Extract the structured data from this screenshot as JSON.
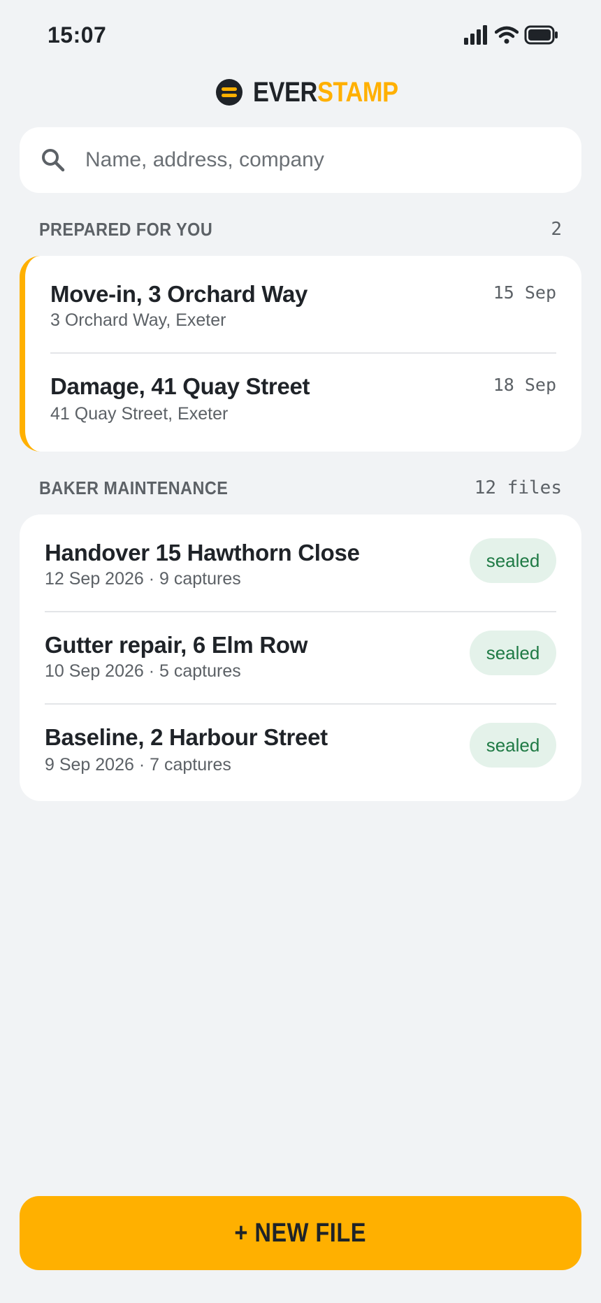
{
  "status_bar": {
    "time": "15:07",
    "icons": [
      "signal-icon",
      "wifi-icon",
      "battery-icon"
    ]
  },
  "brand": {
    "name_part1": "EVER",
    "name_part2": "STAMP",
    "logo_icon": "stamp-logo-icon",
    "colors": {
      "dark": "#1f2328",
      "accent": "#ffb000"
    }
  },
  "search": {
    "placeholder": "Name, address, company",
    "value": "",
    "icon": "search-icon"
  },
  "prepared_section": {
    "title": "PREPARED FOR YOU",
    "count": "2",
    "items": [
      {
        "title": "Move-in, 3 Orchard Way",
        "address": "3 Orchard Way, Exeter",
        "date": "15 Sep"
      },
      {
        "title": "Damage, 41 Quay Street",
        "address": "41 Quay Street, Exeter",
        "date": "18 Sep"
      }
    ]
  },
  "company_section": {
    "title": "BAKER MAINTENANCE",
    "count": "12 files",
    "items": [
      {
        "title": "Handover 15 Hawthorn Close",
        "meta": "12 Sep 2026 · 9 captures",
        "status": "sealed"
      },
      {
        "title": "Gutter repair, 6 Elm Row",
        "meta": "10 Sep 2026 · 5 captures",
        "status": "sealed"
      },
      {
        "title": "Baseline, 2 Harbour Street",
        "meta": "9 Sep 2026 · 7 captures",
        "status": "sealed"
      }
    ]
  },
  "actions": {
    "new_file_label": "+ NEW FILE"
  },
  "colors": {
    "background": "#f1f3f5",
    "accent": "#ffb000",
    "badge_bg": "#e4f2ea",
    "badge_text": "#1f7a45"
  }
}
